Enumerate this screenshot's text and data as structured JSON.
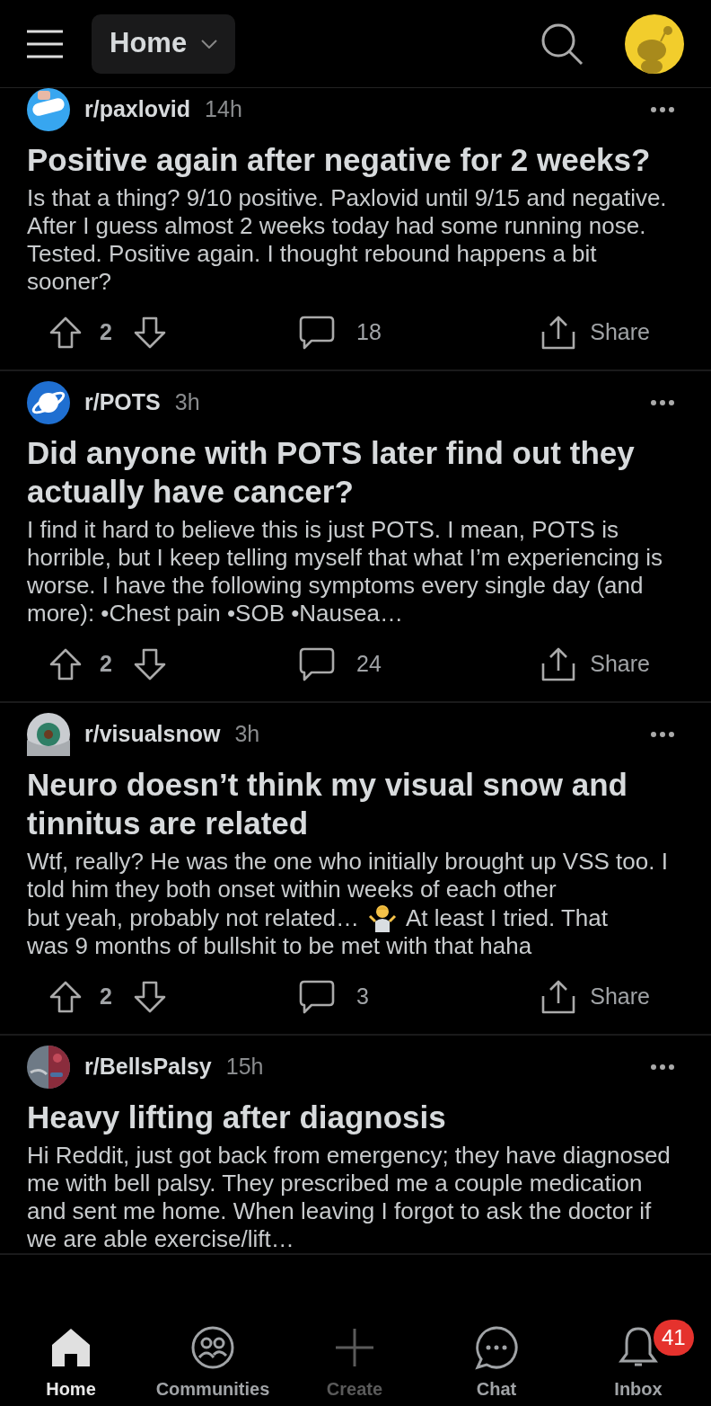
{
  "header": {
    "feed_label": "Home"
  },
  "posts": [
    {
      "subreddit": "r/paxlovid",
      "time": "14h",
      "title": "Positive again after negative for 2 weeks?",
      "body": [
        {
          "kind": "text",
          "text": "Is that a thing? 9/10 positive. Paxlovid until 9/15 and negative. After I guess almost 2 weeks today had some running nose. Tested. Positive again. I thought rebound happens a bit sooner?"
        }
      ],
      "votes": "2",
      "comments": "18",
      "share": "Share"
    },
    {
      "subreddit": "r/POTS",
      "time": "3h",
      "title": "Did anyone with POTS later find out they actually have cancer?",
      "body": [
        {
          "kind": "text",
          "text": "I find it hard to believe this is just POTS. I mean, POTS is horrible, but I keep telling myself that what I’m experiencing is worse. I have the following symptoms every single day (and more): •Chest pain •SOB •Nausea…"
        }
      ],
      "votes": "2",
      "comments": "24",
      "share": "Share"
    },
    {
      "subreddit": "r/visualsnow",
      "time": "3h",
      "title": "Neuro doesn’t think my visual snow and tinnitus are related",
      "body": [
        {
          "kind": "text",
          "text": "Wtf, really? He was the one who initially brought up VSS too. I told him they both onset within weeks of each other"
        },
        {
          "kind": "inline",
          "text": "but yeah, probably not related…"
        },
        {
          "kind": "shrug"
        },
        {
          "kind": "inline",
          "text": "At least I tried. That"
        },
        {
          "kind": "text",
          "text": "was 9 months of bullshit to be met with that haha"
        }
      ],
      "votes": "2",
      "comments": "3",
      "share": "Share"
    },
    {
      "subreddit": "r/BellsPalsy",
      "time": "15h",
      "title": "Heavy lifting after diagnosis",
      "body": [
        {
          "kind": "text",
          "text": "Hi Reddit, just got back from emergency; they have diagnosed me with  bell palsy. They prescribed me a couple medication and sent me home. When leaving I forgot to ask the doctor if we are able exercise/lift…"
        }
      ]
    }
  ],
  "nav": [
    {
      "label": "Home",
      "selected": true,
      "disabled": false
    },
    {
      "label": "Communities",
      "selected": false,
      "disabled": false
    },
    {
      "label": "Create",
      "selected": false,
      "disabled": true
    },
    {
      "label": "Chat",
      "selected": false,
      "disabled": false
    },
    {
      "label": "Inbox",
      "selected": false,
      "disabled": false,
      "badge": "41"
    }
  ]
}
